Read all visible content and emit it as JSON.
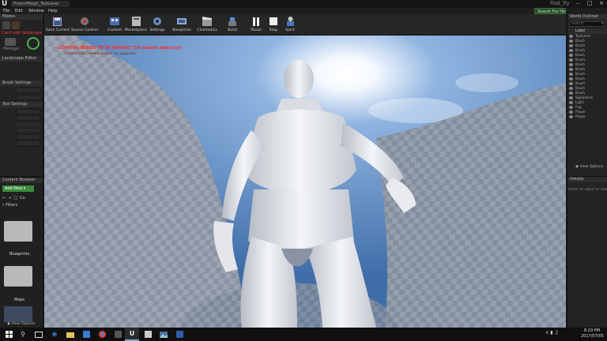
{
  "titlebar": {
    "tab": "ProjectMagic_TestLevel",
    "project": "First_Try",
    "search_help": "Search For Help"
  },
  "menu": [
    "File",
    "Edit",
    "Window",
    "Help"
  ],
  "left_panel": {
    "tab": "Modes",
    "error": "Can't edit landscape",
    "manage": "Manage",
    "landscape_editor": "Landscape Editor",
    "brush_settings": "Brush Settings",
    "tool_settings": "Tool Settings"
  },
  "toolbar": [
    {
      "label": "Save Current",
      "icon": "save-icon"
    },
    {
      "label": "Source Control",
      "icon": "source-control-icon"
    },
    {
      "label": "Content",
      "icon": "content-icon"
    },
    {
      "label": "Marketplace",
      "icon": "marketplace-icon"
    },
    {
      "label": "Settings",
      "icon": "settings-icon"
    },
    {
      "label": "Blueprints",
      "icon": "blueprints-icon"
    },
    {
      "label": "Cinematics",
      "icon": "cinematics-icon"
    },
    {
      "label": "Build",
      "icon": "build-icon"
    },
    {
      "label": "Pause",
      "icon": "pause-icon"
    },
    {
      "label": "Stop",
      "icon": "stop-icon"
    },
    {
      "label": "Eject",
      "icon": "eject-icon"
    }
  ],
  "viewport": {
    "warning": "LIGHTING NEEDS TO BE REBUILT (54 unbuilt object(s))",
    "warning_sub": "'DisableAllScreenMessages' to suppress"
  },
  "outliner": {
    "tab": "World Outliner",
    "search_placeholder": "Search",
    "column": "Label",
    "items": [
      "TestLevel",
      "Brush",
      "Brush",
      "Brush",
      "Brush",
      "Brush",
      "Brush",
      "Brush",
      "Brush",
      "Brush",
      "Brush",
      "Brush",
      "Brush",
      "SkySphere",
      "Light",
      "Fog",
      "Player",
      "Player"
    ],
    "view_options": "View Options"
  },
  "details": {
    "tab": "Details",
    "hint": "Select an object to view details."
  },
  "content_browser": {
    "tab": "Content Browser",
    "add_new": "Add New",
    "path": "Co",
    "filters": "Filters",
    "folders": [
      "Blueprints",
      "Maps"
    ],
    "view_options": "View Options"
  },
  "taskbar": {
    "time": "8:29 PM",
    "date": "2017/07/05"
  }
}
